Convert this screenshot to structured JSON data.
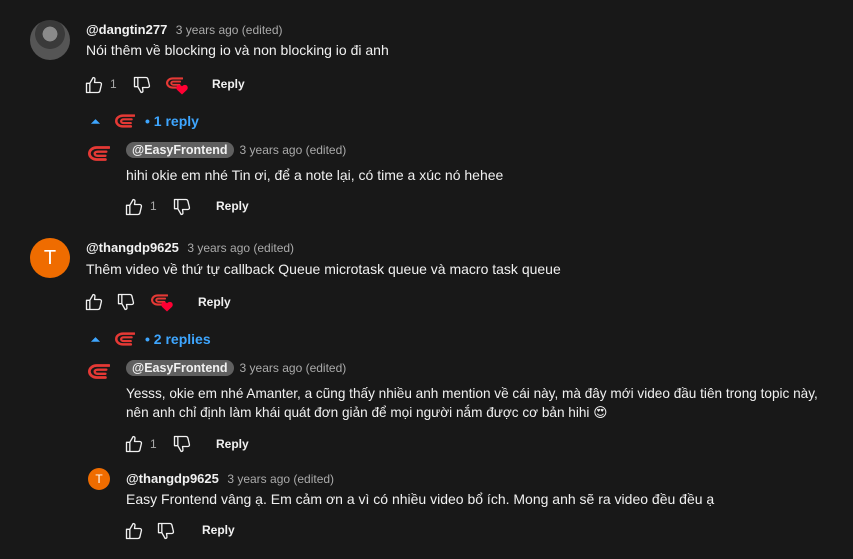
{
  "comments": [
    {
      "author": "@dangtin277",
      "time": "3 years ago (edited)",
      "text": "Nói thêm về blocking io và non blocking io đi  anh",
      "likes": "1",
      "reply_label": "Reply",
      "replies_toggle": "1 reply",
      "replies": [
        {
          "author": "@EasyFrontend",
          "time": "3 years ago (edited)",
          "text": "hihi okie em nhé Tin ơi, để a note lại, có time a xúc nó hehee",
          "likes": "1",
          "reply_label": "Reply"
        }
      ]
    },
    {
      "author": "@thangdp9625",
      "avatar_letter": "T",
      "time": "3 years ago (edited)",
      "text": "Thêm video về thứ tự callback Queue microtask queue và macro task queue",
      "reply_label": "Reply",
      "replies_toggle": "2 replies",
      "replies": [
        {
          "author": "@EasyFrontend",
          "time": "3 years ago (edited)",
          "text_line1": "Yesss, okie em nhé Amanter, a cũng thấy nhiều anh mention về cái này, mà đây mới video đầu tiên trong topic này,",
          "text_line2": "nên anh chỉ định làm khái quát đơn giản để mọi người nắm được cơ bản hihi 😍",
          "likes": "1",
          "reply_label": "Reply"
        },
        {
          "author": "@thangdp9625",
          "avatar_letter": "T",
          "time": "3 years ago (edited)",
          "text": "Easy Frontend vâng ạ. Em cảm ơn a vì có nhiều video bổ ích. Mong anh sẽ ra video đều đều ạ",
          "reply_label": "Reply"
        }
      ]
    }
  ],
  "colors": {
    "background": "#181818",
    "link_blue": "#3ea6ff",
    "brand_red": "#e53935",
    "heart_red": "#ff0033",
    "avatar_orange": "#ef6c00",
    "owner_badge": "#606060"
  },
  "icons": [
    "like-icon",
    "dislike-icon",
    "creator-heart-icon",
    "chevron-up-icon",
    "easyfrontend-logo-icon"
  ]
}
